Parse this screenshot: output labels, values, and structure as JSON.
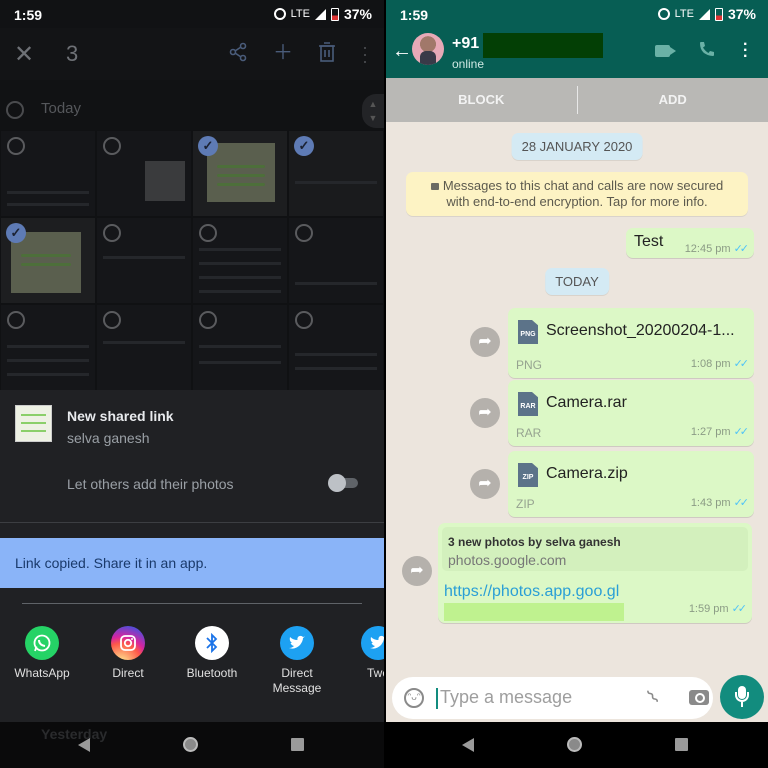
{
  "status_bar": {
    "time": "1:59",
    "network": "LTE",
    "battery": "37%"
  },
  "photos_app": {
    "toolbar": {
      "close_icon": "close-icon",
      "selected_count": "3",
      "actions": [
        "share-icon",
        "add-icon",
        "delete-icon",
        "more-vert-icon"
      ]
    },
    "section_today": "Today",
    "section_yesterday": "Yesterday",
    "grid": {
      "total_cells": 12,
      "selected_cells": [
        2,
        3,
        4
      ]
    },
    "share_sheet": {
      "title": "New shared link",
      "owner": "selva ganesh",
      "toggle_label": "Let others add their photos",
      "toggle_on": false,
      "snackbar": "Link copied. Share it in an app.",
      "apps": [
        {
          "label": "WhatsApp",
          "icon": "whatsapp-icon",
          "color": "#25d366"
        },
        {
          "label": "Direct",
          "icon": "instagram-icon",
          "color": "#d6249f"
        },
        {
          "label": "Bluetooth",
          "icon": "bluetooth-icon",
          "color": "#ffffff"
        },
        {
          "label": "Direct Message",
          "icon": "twitter-icon",
          "color": "#1da1f2"
        },
        {
          "label": "Twe",
          "icon": "twitter-icon",
          "color": "#1da1f2"
        }
      ]
    }
  },
  "whatsapp": {
    "header": {
      "contact_prefix": "+91",
      "presence": "online"
    },
    "action_bar": {
      "block": "BLOCK",
      "add": "ADD"
    },
    "date_chip_1": "28 JANUARY 2020",
    "encryption_notice_1": "Messages to this chat and calls are now secured",
    "encryption_notice_2": "with end-to-end encryption. Tap for more info.",
    "messages": [
      {
        "text": "Test",
        "time": "12:45 pm",
        "ticks": "✓✓"
      },
      {
        "file": "Screenshot_20200204-1...",
        "type": "PNG",
        "time": "1:08 pm",
        "ticks": "✓✓"
      },
      {
        "file": "Camera.rar",
        "type": "RAR",
        "time": "1:27 pm",
        "ticks": "✓✓"
      },
      {
        "file": "Camera.zip",
        "type": "ZIP",
        "time": "1:43 pm",
        "ticks": "✓✓"
      },
      {
        "link_title": "3 new photos by selva ganesh",
        "link_site": "photos.google.com",
        "url": "https://photos.app.goo.gl",
        "time": "1:59 pm",
        "ticks": "✓✓"
      }
    ],
    "date_chip_2": "TODAY",
    "input": {
      "placeholder": "Type a message"
    },
    "colors": {
      "header": "#075e54",
      "outgoing": "#dcf8c6",
      "accent": "#128c7e"
    }
  }
}
